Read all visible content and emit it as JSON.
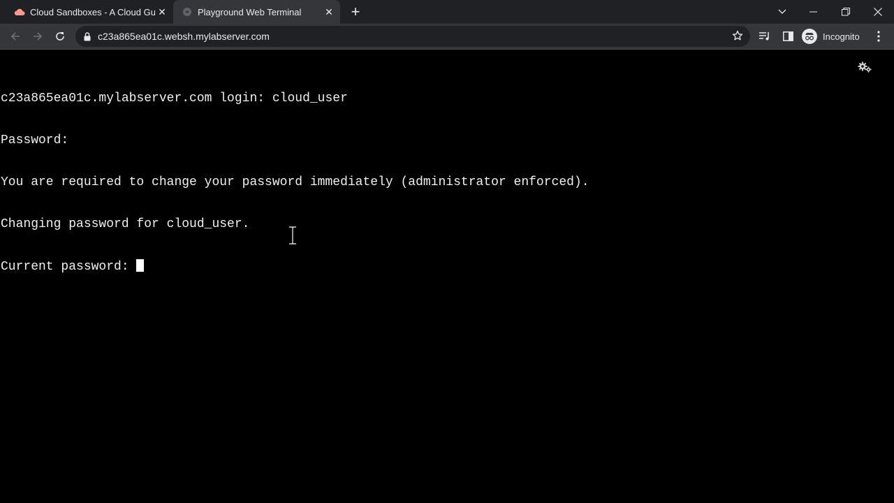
{
  "tabs": [
    {
      "title": "Cloud Sandboxes - A Cloud Guru",
      "favicon": "cloud-icon",
      "active": false
    },
    {
      "title": "Playground Web Terminal",
      "favicon": "globe-icon",
      "active": true
    }
  ],
  "toolbar": {
    "url": "c23a865ea01c.websh.mylabserver.com",
    "profile_label": "Incognito"
  },
  "terminal": {
    "lines": [
      "c23a865ea01c.mylabserver.com login: cloud_user",
      "Password:",
      "You are required to change your password immediately (administrator enforced).",
      "Changing password for cloud_user.",
      "Current password: "
    ]
  },
  "colors": {
    "tabstrip_bg": "#202124",
    "toolbar_bg": "#35363a",
    "terminal_bg": "#000000",
    "terminal_fg": "#f0f0f0"
  }
}
